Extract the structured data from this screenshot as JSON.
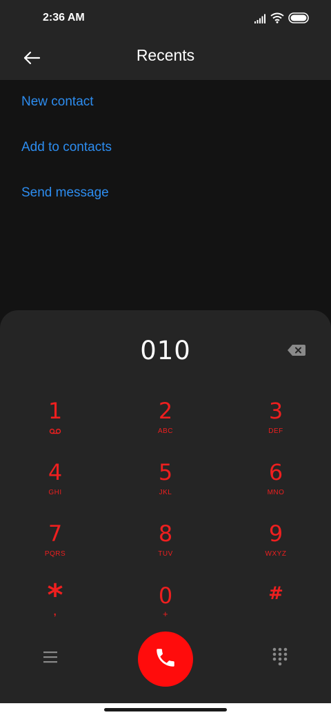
{
  "status_bar": {
    "time": "2:36 AM",
    "icons": [
      "signal-icon",
      "wifi-icon",
      "battery-icon"
    ]
  },
  "header": {
    "title": "Recents",
    "back_icon": "back-arrow-icon"
  },
  "actions": [
    {
      "label": "New contact"
    },
    {
      "label": "Add to contacts"
    },
    {
      "label": "Send message"
    }
  ],
  "dialpad": {
    "number": "010",
    "keys": [
      {
        "digit": "1",
        "letters": ""
      },
      {
        "digit": "2",
        "letters": "ABC"
      },
      {
        "digit": "3",
        "letters": "DEF"
      },
      {
        "digit": "4",
        "letters": "GHI"
      },
      {
        "digit": "5",
        "letters": "JKL"
      },
      {
        "digit": "6",
        "letters": "MNO"
      },
      {
        "digit": "7",
        "letters": "PQRS"
      },
      {
        "digit": "8",
        "letters": "TUV"
      },
      {
        "digit": "9",
        "letters": "WXYZ"
      },
      {
        "digit": "*",
        "letters": ","
      },
      {
        "digit": "0",
        "letters": "+"
      },
      {
        "digit": "#",
        "letters": ""
      }
    ],
    "key1_icon": "voicemail-icon"
  },
  "bottom_bar": {
    "left_icon": "menu-icon",
    "call_icon": "phone-icon",
    "right_icon": "keypad-icon"
  },
  "colors": {
    "accent": "#2d8df0",
    "key_color": "#ee1f1f",
    "call_button": "#ff0c0c",
    "panel": "#252525",
    "background": "#131313"
  }
}
